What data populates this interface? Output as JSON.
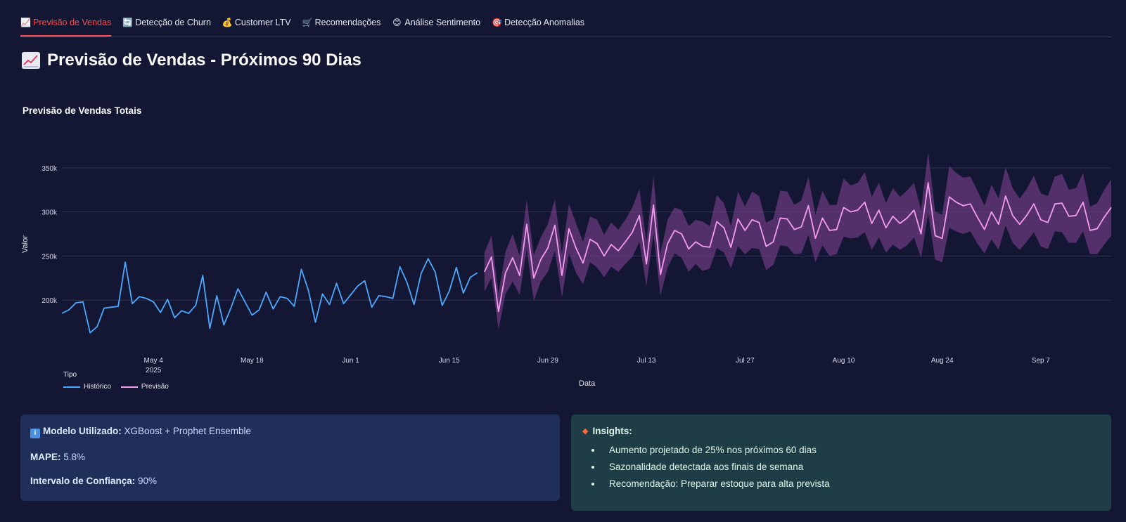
{
  "tabs": [
    {
      "icon": "📈",
      "label": "Previsão de Vendas",
      "active": true
    },
    {
      "icon": "🔄",
      "label": "Detecção de Churn"
    },
    {
      "icon": "💰",
      "label": "Customer LTV"
    },
    {
      "icon": "🛒",
      "label": "Recomendações"
    },
    {
      "icon": "😊",
      "label": "Análise Sentimento"
    },
    {
      "icon": "🎯",
      "label": "Detecção Anomalias"
    }
  ],
  "page": {
    "title": "Previsão de Vendas - Próximos 90 Dias"
  },
  "chart_data": {
    "type": "line",
    "title": "Previsão de Vendas Totais",
    "xlabel": "Data",
    "ylabel": "Valor",
    "ylim": [
      150000,
      365000
    ],
    "y_ticks": [
      {
        "v": 200000,
        "label": "200k"
      },
      {
        "v": 250000,
        "label": "250k"
      },
      {
        "v": 300000,
        "label": "300k"
      },
      {
        "v": 350000,
        "label": "350k"
      }
    ],
    "x_start": "2025-04-21",
    "x_ticks": [
      {
        "date": "2025-05-04",
        "label": "May 4",
        "sub": "2025"
      },
      {
        "date": "2025-05-18",
        "label": "May 18"
      },
      {
        "date": "2025-06-01",
        "label": "Jun 1"
      },
      {
        "date": "2025-06-15",
        "label": "Jun 15"
      },
      {
        "date": "2025-06-29",
        "label": "Jun 29"
      },
      {
        "date": "2025-07-13",
        "label": "Jul 13"
      },
      {
        "date": "2025-07-27",
        "label": "Jul 27"
      },
      {
        "date": "2025-08-10",
        "label": "Aug 10"
      },
      {
        "date": "2025-08-24",
        "label": "Aug 24"
      },
      {
        "date": "2025-09-07",
        "label": "Sep 7"
      }
    ],
    "grid": true,
    "legend_title": "Tipo",
    "legend_position": "bottom-left",
    "colors": {
      "historico": "#4aa8ff",
      "previsao": "#f39cf0",
      "band": "#6a3a7e"
    },
    "series": [
      {
        "name": "Histórico",
        "start_date": "2025-04-21",
        "values": [
          185000,
          189000,
          197000,
          198000,
          163000,
          170000,
          191000,
          192000,
          193000,
          243000,
          196000,
          204000,
          202000,
          198000,
          186000,
          201000,
          180000,
          188000,
          185000,
          194000,
          228000,
          168000,
          205000,
          172000,
          191000,
          213000,
          198000,
          183000,
          189000,
          209000,
          190000,
          204000,
          202000,
          193000,
          235000,
          211000,
          175000,
          207000,
          195000,
          219000,
          196000,
          206000,
          216000,
          222000,
          192000,
          205000,
          204000,
          202000,
          238000,
          220000,
          195000,
          230000,
          247000,
          232000,
          194000,
          210000,
          237000,
          208000,
          226000,
          231000
        ]
      },
      {
        "name": "Previsão",
        "start_date": "2025-06-20",
        "values": [
          232000,
          249000,
          187000,
          231000,
          248000,
          228000,
          286000,
          225000,
          246000,
          259000,
          285000,
          228000,
          281000,
          259000,
          242000,
          269000,
          264000,
          250000,
          263000,
          256000,
          266000,
          277000,
          296000,
          241000,
          308000,
          229000,
          264000,
          279000,
          275000,
          258000,
          266000,
          261000,
          260000,
          289000,
          282000,
          260000,
          292000,
          279000,
          291000,
          288000,
          261000,
          266000,
          293000,
          292000,
          280000,
          283000,
          307000,
          270000,
          293000,
          279000,
          280000,
          305000,
          300000,
          302000,
          311000,
          287000,
          302000,
          282000,
          295000,
          287000,
          293000,
          302000,
          275000,
          333000,
          273000,
          270000,
          317000,
          311000,
          307000,
          309000,
          294000,
          280000,
          300000,
          286000,
          318000,
          296000,
          286000,
          296000,
          309000,
          291000,
          288000,
          309000,
          310000,
          295000,
          296000,
          311000,
          279000,
          281000,
          294000,
          305000
        ]
      },
      {
        "name": "Intervalo",
        "start_date": "2025-06-20",
        "spread": [
          22000,
          24000,
          20000,
          24000,
          27000,
          22000,
          28000,
          26000,
          25000,
          27000,
          29000,
          25000,
          28000,
          28000,
          24000,
          26000,
          27000,
          24000,
          25000,
          24000,
          25000,
          28000,
          30000,
          25000,
          33000,
          24000,
          27000,
          26000,
          27000,
          26000,
          25000,
          28000,
          24000,
          30000,
          28000,
          24000,
          31000,
          27000,
          32000,
          30000,
          27000,
          26000,
          31000,
          31000,
          28000,
          30000,
          33000,
          27000,
          31000,
          29000,
          28000,
          33000,
          30000,
          31000,
          34000,
          30000,
          31000,
          28000,
          32000,
          30000,
          31000,
          31000,
          27000,
          35000,
          27000,
          27000,
          35000,
          33000,
          32000,
          31000,
          30000,
          27000,
          31000,
          29000,
          33000,
          31000,
          29000,
          30000,
          32000,
          30000,
          30000,
          31000,
          33000,
          30000,
          31000,
          33000,
          27000,
          29000,
          31000,
          32000
        ]
      }
    ]
  },
  "model_info": {
    "model_label": "Modelo Utilizado:",
    "model_value": " XGBoost + Prophet Ensemble",
    "mape_label": "MAPE:",
    "mape_value": " 5.8%",
    "ci_label": "Intervalo de Confiança:",
    "ci_value": " 90%"
  },
  "insights": {
    "title": "Insights:",
    "items": [
      "Aumento projetado de 25% nos próximos 60 dias",
      "Sazonalidade detectada aos finais de semana",
      "Recomendação: Preparar estoque para alta prevista"
    ]
  }
}
